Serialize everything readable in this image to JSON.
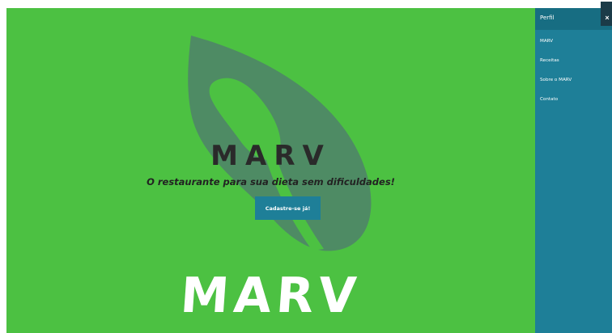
{
  "hero": {
    "title": "MARV",
    "tagline": "O restaurante para sua dieta sem dificuldades!",
    "cta_label": "Cadastre-se já!",
    "logo_text": "MARV",
    "background_color": "#4cc142",
    "leaf_color": "#4e8b64",
    "button_color": "#1e7f98"
  },
  "sidebar": {
    "header_label": "Perfil",
    "close_glyph": "×",
    "items": [
      {
        "label": "MARV"
      },
      {
        "label": "Receitas"
      },
      {
        "label": "Sobre o MARV"
      },
      {
        "label": "Contato"
      }
    ],
    "background_color": "#1e7f98"
  }
}
